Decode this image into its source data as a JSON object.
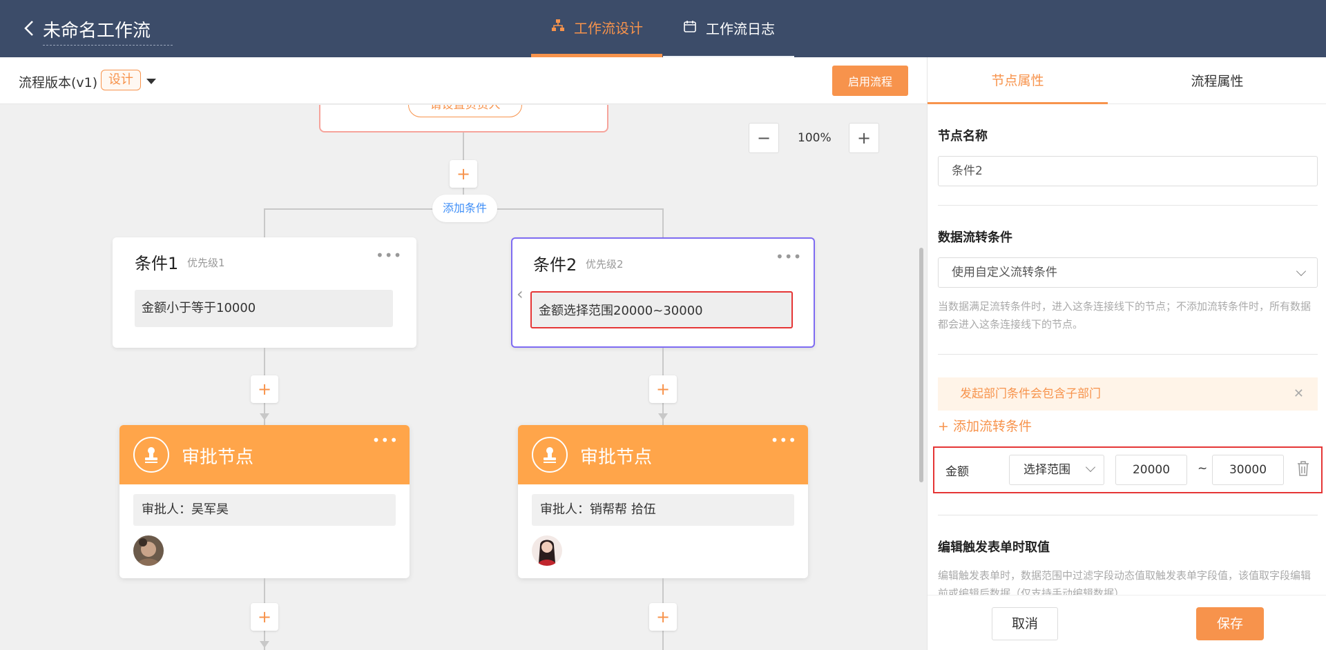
{
  "header": {
    "title": "未命名工作流",
    "tabs": [
      {
        "label": "工作流设计",
        "icon": "sitemap-icon"
      },
      {
        "label": "工作流日志",
        "icon": "calendar-icon"
      }
    ]
  },
  "version_bar": {
    "label": "流程版本(v1)",
    "badge": "设计",
    "enable_button": "启用流程"
  },
  "canvas": {
    "top_node_button": "请设置负责人",
    "add_condition": "添加条件",
    "zoom": "100%",
    "conditions": [
      {
        "title": "条件1",
        "priority": "优先级1",
        "body": "金额小于等于10000"
      },
      {
        "title": "条件2",
        "priority": "优先级2",
        "body": "金额选择范围20000~30000"
      }
    ],
    "approvals": [
      {
        "title": "审批节点",
        "approver": "审批人：吴军昊"
      },
      {
        "title": "审批节点",
        "approver": "审批人：销帮帮 拾伍"
      }
    ]
  },
  "panel": {
    "tabs": [
      "节点属性",
      "流程属性"
    ],
    "node_name_label": "节点名称",
    "node_name_value": "条件2",
    "flow_condition_label": "数据流转条件",
    "flow_condition_select": "使用自定义流转条件",
    "flow_condition_hint": "当数据满足流转条件时，进入这条连接线下的节点；不添加流转条件时，所有数据都会进入这条连接线下的节点。",
    "notice": "发起部门条件会包含子部门",
    "add_rule": "+ 添加流转条件",
    "rule": {
      "field": "金额",
      "operator": "选择范围",
      "min": "20000",
      "tilde": "~",
      "max": "30000"
    },
    "edit_trigger_label": "编辑触发表单时取值",
    "edit_trigger_hint": "编辑触发表单时，数据范围中过滤字段动态值取触发表单字段值，该值取字段编辑前或编辑后数据（仅支持手动编辑数据）",
    "cancel": "取消",
    "save": "保存"
  },
  "colors": {
    "header_bg": "#3c4c69",
    "accent": "#f7934c",
    "approval_header": "#ffa54a",
    "selected_border": "#7e6bf2",
    "highlight_red": "#e53535"
  }
}
